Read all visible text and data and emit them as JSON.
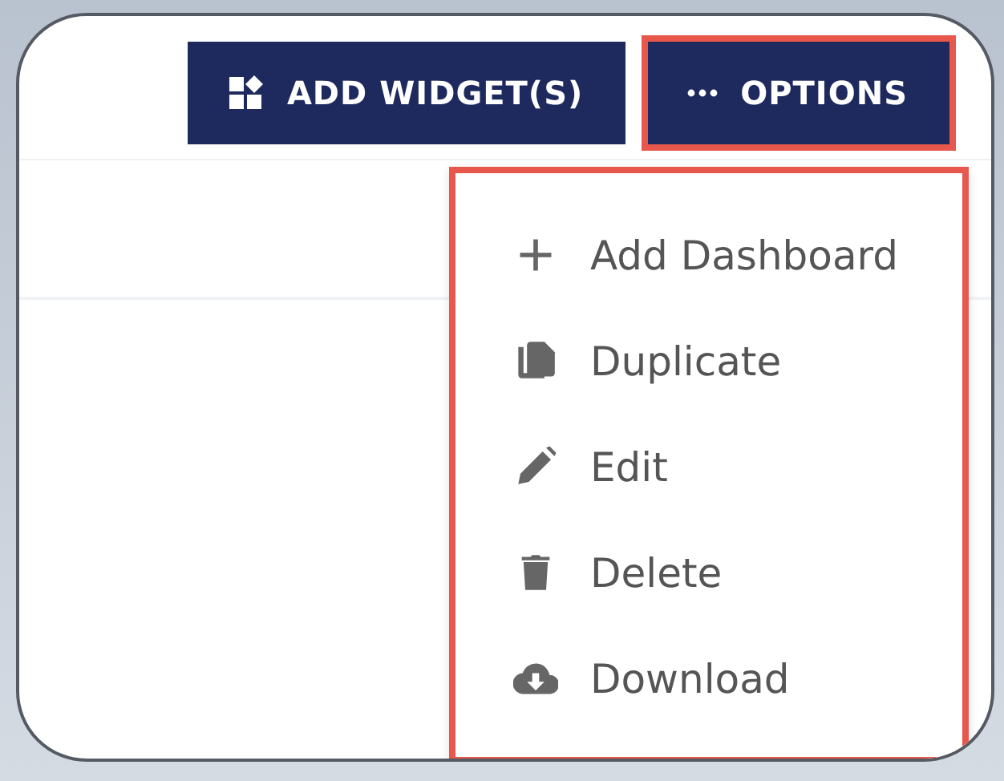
{
  "toolbar": {
    "buttons": [
      {
        "kind": "widgets",
        "label": "ADD WIDGET(S)",
        "highlighted": false
      },
      {
        "kind": "options",
        "label": "OPTIONS",
        "highlighted": true
      }
    ]
  },
  "options_menu": {
    "highlighted": true,
    "items": [
      {
        "kind": "add",
        "label": "Add Dashboard"
      },
      {
        "kind": "duplicate",
        "label": "Duplicate"
      },
      {
        "kind": "edit",
        "label": "Edit"
      },
      {
        "kind": "delete",
        "label": "Delete"
      },
      {
        "kind": "download",
        "label": "Download"
      }
    ]
  }
}
